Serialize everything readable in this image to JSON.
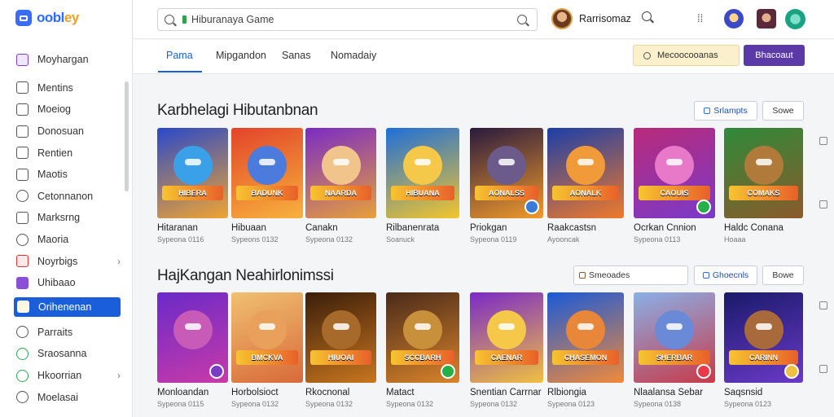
{
  "app": {
    "brand_name_main": "oobl",
    "brand_name_tail": "ey"
  },
  "sidebar": {
    "items": [
      {
        "label": "Moyhargan",
        "icon": "grid-icon",
        "style": "purple"
      },
      {
        "label": "Mentins",
        "icon": "image-icon",
        "style": ""
      },
      {
        "label": "Moeiog",
        "icon": "gamepad-icon",
        "style": ""
      },
      {
        "label": "Donosuan",
        "icon": "chat-icon",
        "style": ""
      },
      {
        "label": "Rentien",
        "icon": "window-icon",
        "style": ""
      },
      {
        "label": "Maotis",
        "icon": "table-icon",
        "style": ""
      },
      {
        "label": "Cetonnanon",
        "icon": "disc-icon",
        "style": "round"
      },
      {
        "label": "Marksrng",
        "icon": "wrench-icon",
        "style": ""
      },
      {
        "label": "Maoria",
        "icon": "link-icon",
        "style": "round"
      },
      {
        "label": "Noyrbigs",
        "icon": "flag-icon",
        "style": "red",
        "chevron": "›"
      },
      {
        "label": "Uhibaao",
        "icon": "star-icon",
        "style": "violet"
      }
    ],
    "active_item": {
      "label": "Orihenenan",
      "icon": "folder-icon"
    },
    "bottom_items": [
      {
        "label": "Parraits",
        "icon": "pin-icon",
        "style": "round"
      },
      {
        "label": "Sraosanna",
        "icon": "refresh-icon",
        "style": "green"
      },
      {
        "label": "Hkoorrian",
        "icon": "shield-icon",
        "style": "green",
        "chevron": "›"
      },
      {
        "label": "Moelasai",
        "icon": "user-icon",
        "style": "round"
      }
    ]
  },
  "header": {
    "search_value": "Hiburanaya Game",
    "user_name": "Rarrisomaz",
    "apps_glyph": "⁞⁞"
  },
  "tabs": {
    "items": [
      "Pama",
      "Mipgandon",
      "Sanas",
      "Nomadaiy"
    ],
    "newsletter_label": "Mecoocooanas",
    "primary_button_label": "Bhacoaut"
  },
  "sections": [
    {
      "title": "Karbhelagi Hibutanbnan",
      "pill_1": "Srlampts",
      "pill_2": "Sowe",
      "games": [
        {
          "title": "Hitaranan",
          "sub": "Sypeona  0116",
          "banner": "HIBERA",
          "colors": [
            "#2a49c8",
            "#f0a431"
          ],
          "figure": "#3aa0e8"
        },
        {
          "title": "Hibuaan",
          "sub": "Sypeons 0132",
          "banner": "BADUNK",
          "colors": [
            "#e3442a",
            "#f7b23c"
          ],
          "figure": "#4b7bdc"
        },
        {
          "title": "Canakn",
          "sub": "Sypeona  0132",
          "banner": "NAARDA",
          "colors": [
            "#7a2cc4",
            "#e8a03a"
          ],
          "figure": "#f0c48a"
        },
        {
          "title": "Rilbanenrata",
          "sub": "Soanuck",
          "banner": "HIBUANA",
          "colors": [
            "#1e6fd8",
            "#f3c52c"
          ],
          "figure": "#f6c84a"
        },
        {
          "title": "Priokgan",
          "sub": "Sypeona 0119",
          "banner": "AONALSS",
          "colors": [
            "#2a1a3e",
            "#f09a2a"
          ],
          "figure": "#6b5a8a"
        },
        {
          "title": "Raakcastsn",
          "sub": "Ayooncak",
          "banner": "AONALK",
          "colors": [
            "#1b3ea8",
            "#f07a2a"
          ],
          "figure": "#f09a3a"
        },
        {
          "title": "Ocrkan Cnnion",
          "sub": "Sypeona 0113",
          "banner": "CAOUIS",
          "colors": [
            "#b82a7a",
            "#7a3ac8"
          ],
          "figure": "#e878c8"
        },
        {
          "title": "Haldc Conana",
          "sub": "Hoaaa",
          "banner": "COMAKS",
          "colors": [
            "#2f8a3a",
            "#8a5a2a"
          ],
          "figure": "#b07a3a"
        }
      ]
    },
    {
      "title": "HajKangan Neahirlonimssi",
      "search_pill": "Smeoades",
      "pill_1": "Ghoecnls",
      "pill_2": "Bowe",
      "games": [
        {
          "title": "Monloandan",
          "sub": "Sypeona  0115",
          "banner": "",
          "colors": [
            "#6a2ac8",
            "#c83aa8"
          ],
          "figure": "#c85ab8"
        },
        {
          "title": "Horbolsioct",
          "sub": "Sypeona 0132",
          "banner": "BMCKVA",
          "colors": [
            "#f0c070",
            "#d86a3a"
          ],
          "figure": "#e8a05a"
        },
        {
          "title": "Rkocnonal",
          "sub": "Sypeona  0132",
          "banner": "HIUOAI",
          "colors": [
            "#3a1e0a",
            "#c8761e"
          ],
          "figure": "#a86a2a"
        },
        {
          "title": "Matact",
          "sub": "Sypeona 0132",
          "banner": "SCCBARH",
          "colors": [
            "#4a2a1a",
            "#d8842a"
          ],
          "figure": "#c8903a"
        },
        {
          "title": "Snentian Carrnar",
          "sub": "Sypeona  0132",
          "banner": "CAENAR",
          "colors": [
            "#7a2ac8",
            "#f0c040"
          ],
          "figure": "#f6c84a"
        },
        {
          "title": "Rlbiongia",
          "sub": "Sypeona 0123",
          "banner": "CHASEMON",
          "colors": [
            "#1a5ad8",
            "#f08a3a"
          ],
          "figure": "#e8863a"
        },
        {
          "title": "Nlaalansa Sebar",
          "sub": "Sypeona 0138",
          "banner": "SHERBAR",
          "colors": [
            "#8ab0e8",
            "#c83a4a"
          ],
          "figure": "#6a8ad8"
        },
        {
          "title": "Saqsnsid",
          "sub": "Sypeona 0123",
          "banner": "CARINN",
          "colors": [
            "#1a1a6a",
            "#6a3ac8"
          ],
          "figure": "#a86a3a"
        }
      ]
    }
  ]
}
